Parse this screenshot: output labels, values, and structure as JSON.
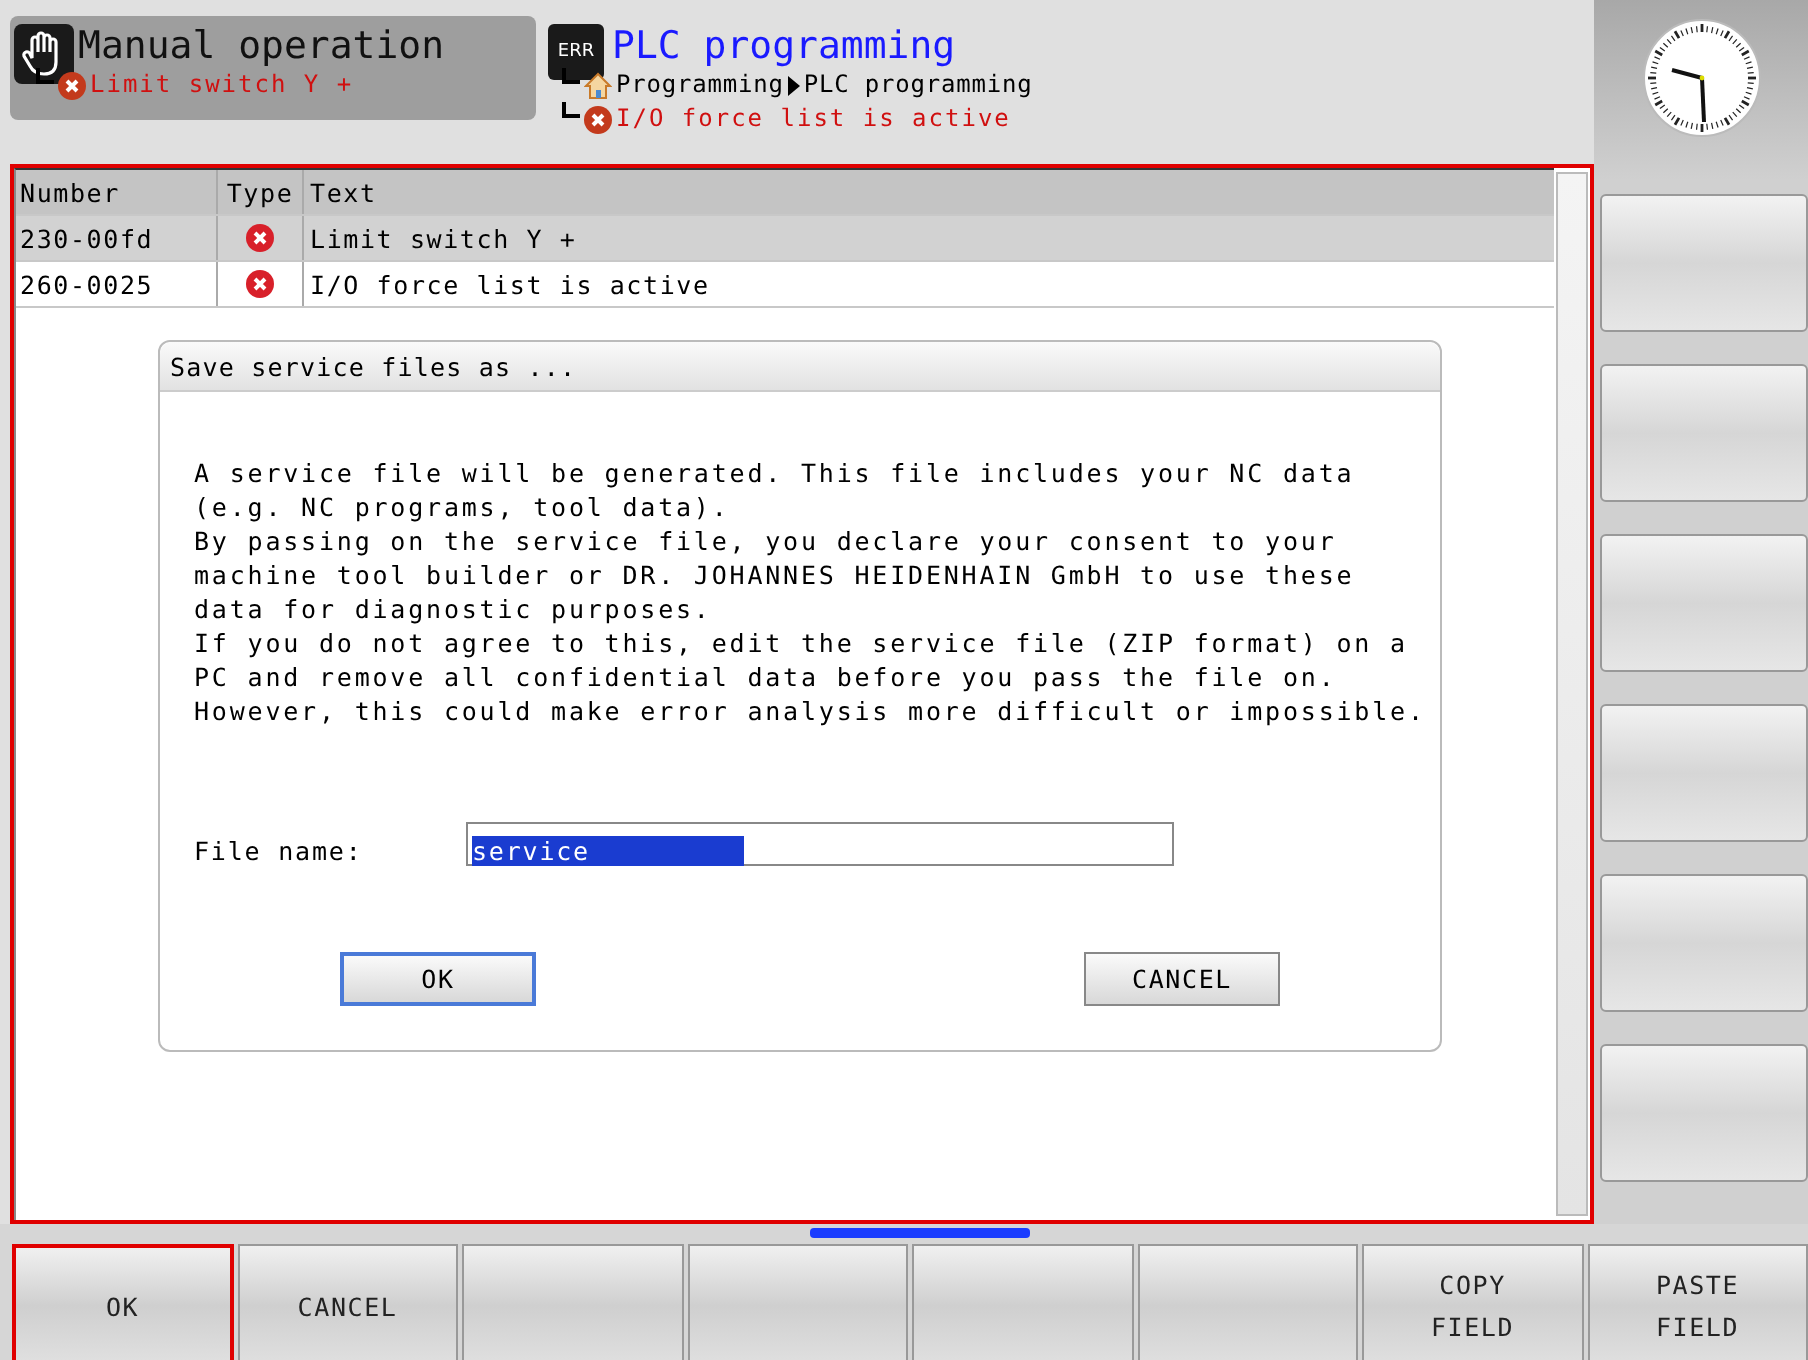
{
  "mode_tab": {
    "title": "Manual operation",
    "message": "Limit switch Y +"
  },
  "program_tab": {
    "badge": "ERR",
    "title": "PLC programming",
    "path": [
      "Programming",
      "PLC programming"
    ],
    "message": "I/O force list is active"
  },
  "table": {
    "columns": [
      "Number",
      "Type",
      "Text"
    ],
    "rows": [
      {
        "number": "230-00fd",
        "text": "Limit switch Y +",
        "selected": true
      },
      {
        "number": "260-0025",
        "text": "I/O force list is active",
        "selected": false
      }
    ]
  },
  "dialog": {
    "title": "Save service files as ...",
    "paragraphs": [
      "A service file will be generated. This file includes your NC data (e.g. NC programs, tool data).",
      "By passing on the service file, you declare your consent to your machine tool builder or DR. JOHANNES HEIDENHAIN GmbH to use these data for diagnostic purposes.",
      "If you do not agree to this, edit the service file (ZIP format) on a PC and remove all confidential data before you pass the file on. However, this could make error analysis more difficult or impossible."
    ],
    "field_label": "File name:",
    "field_value": "service",
    "buttons": [
      {
        "label": "OK",
        "focused": true
      },
      {
        "label": "CANCEL",
        "focused": false
      }
    ]
  },
  "softkeys": [
    {
      "lines": [
        "OK"
      ],
      "selected": true
    },
    {
      "lines": [
        "CANCEL"
      ],
      "selected": false
    },
    {
      "selected": false
    },
    {
      "selected": false
    },
    {
      "selected": false
    },
    {
      "selected": false
    },
    {
      "lines": [
        "COPY",
        "FIELD"
      ],
      "selected": false
    },
    {
      "lines": [
        "PASTE",
        "FIELD"
      ],
      "selected": false
    }
  ]
}
